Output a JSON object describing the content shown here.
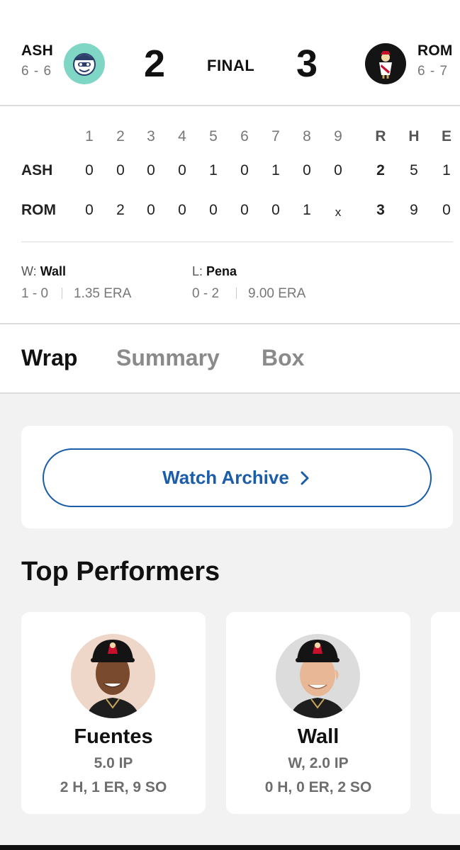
{
  "game": {
    "away": {
      "abbr": "ASH",
      "record": "6 - 6",
      "score": "2",
      "logo_icon": "ash-team-logo",
      "color": "#7fd6c4"
    },
    "home": {
      "abbr": "ROM",
      "record": "6 - 7",
      "score": "3",
      "logo_icon": "rom-team-logo",
      "color": "#141414"
    },
    "status": "FINAL"
  },
  "linescore": {
    "innings": [
      "1",
      "2",
      "3",
      "4",
      "5",
      "6",
      "7",
      "8",
      "9"
    ],
    "totals_headers": [
      "R",
      "H",
      "E"
    ],
    "rows": [
      {
        "team": "ASH",
        "innings": [
          "0",
          "0",
          "0",
          "0",
          "1",
          "0",
          "1",
          "0",
          "0"
        ],
        "totals": [
          "2",
          "5",
          "1"
        ]
      },
      {
        "team": "ROM",
        "innings": [
          "0",
          "2",
          "0",
          "0",
          "0",
          "0",
          "0",
          "1",
          "x"
        ],
        "totals": [
          "3",
          "9",
          "0"
        ]
      }
    ]
  },
  "pitchers": {
    "win": {
      "label": "W:",
      "name": "Wall",
      "record": "1 - 0",
      "era": "1.35 ERA"
    },
    "loss": {
      "label": "L:",
      "name": "Pena",
      "record": "0 - 2",
      "era": "9.00 ERA"
    }
  },
  "tabs": [
    {
      "label": "Wrap",
      "active": true
    },
    {
      "label": "Summary",
      "active": false
    },
    {
      "label": "Box",
      "active": false
    }
  ],
  "watch": {
    "label": "Watch Archive",
    "icon": "chevron-right-icon",
    "color": "#1b5da8"
  },
  "top_performers": {
    "title": "Top Performers",
    "players": [
      {
        "name": "Fuentes",
        "line1": "5.0 IP",
        "line2": "2 H, 1 ER, 9 SO",
        "bg": "#eed7c9"
      },
      {
        "name": "Wall",
        "line1": "W, 2.0 IP",
        "line2": "0 H, 0 ER, 2 SO",
        "bg": "#dcdcdc"
      }
    ]
  }
}
